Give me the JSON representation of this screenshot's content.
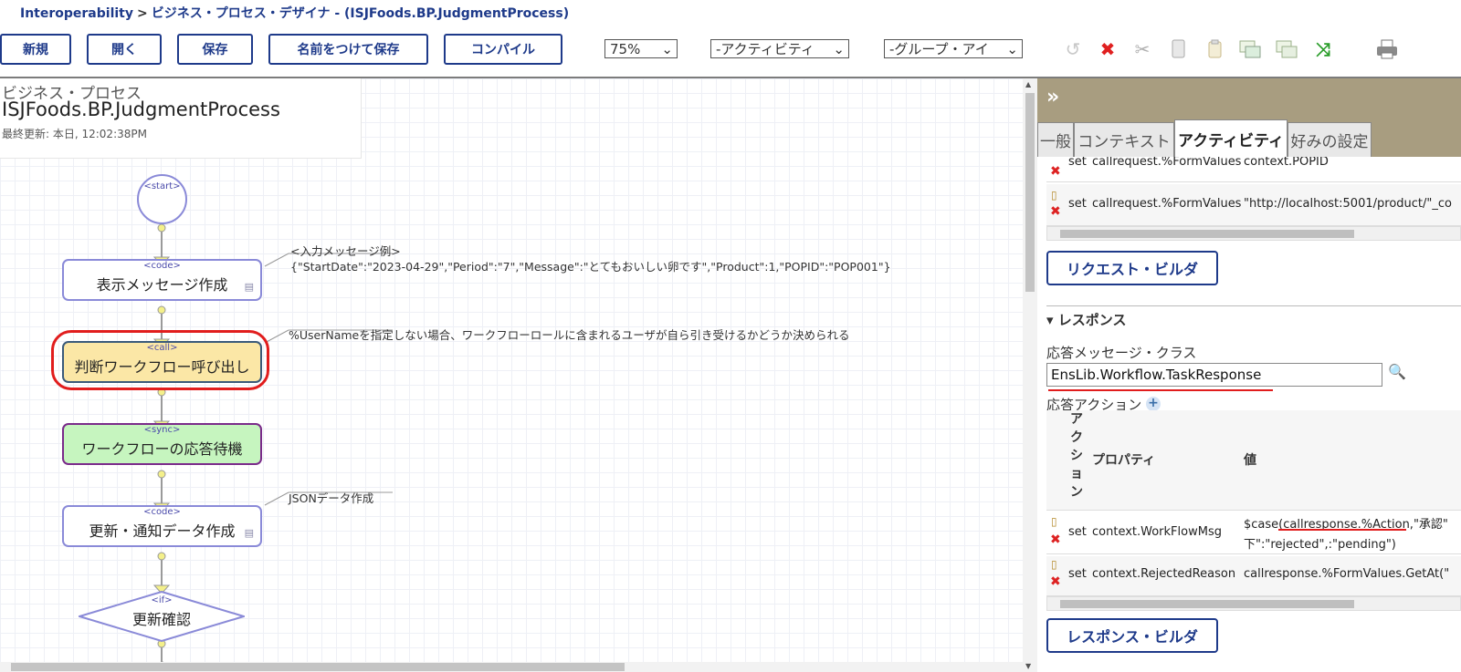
{
  "breadcrumb": {
    "root": "Interoperability",
    "separator": ">",
    "page": "ビジネス・プロセス・デザイナ",
    "suffix": "- (ISJFoods.BP.JudgmentProcess)"
  },
  "toolbar": {
    "buttons": [
      "新規",
      "開く",
      "保存",
      "名前をつけて保存",
      "コンパイル"
    ],
    "zoom": "75%",
    "activity_select": "-アクティビティ",
    "group_select": "-グループ・アイ",
    "icons": [
      "undo-icon",
      "delete-icon",
      "cut-icon",
      "copy-icon",
      "paste-icon",
      "group-icon",
      "ungroup-icon",
      "shuffle-icon",
      "print-icon"
    ]
  },
  "canvas": {
    "header": {
      "kind": "ビジネス・プロセス",
      "name": "ISJFoods.BP.JudgmentProcess",
      "updated": "最終更新: 本日, 12:02:38PM"
    },
    "start": "<start>",
    "nodes": [
      {
        "tag": "<code>",
        "label": "表示メッセージ作成"
      },
      {
        "tag": "<call>",
        "label": "判断ワークフロー呼び出し"
      },
      {
        "tag": "<sync>",
        "label": "ワークフローの応答待機"
      },
      {
        "tag": "<code>",
        "label": "更新・通知データ作成"
      },
      {
        "tag": "<if>",
        "label": "更新確認"
      }
    ],
    "annotations": [
      {
        "title": "<入力メッセージ例>",
        "text": "{\"StartDate\":\"2023-04-29\",\"Period\":\"7\",\"Message\":\"とてもおいしい卵です\",\"Product\":1,\"POPID\":\"POP001\"}"
      },
      {
        "text": "%UserNameを指定しない場合、ワークフローロールに含まれるユーザが自ら引き受けるかどうか決められる"
      },
      {
        "text": "JSONデータ作成"
      }
    ]
  },
  "panel": {
    "collapse": "»",
    "tabs": [
      "一般",
      "コンテキスト",
      "アクティビティ",
      "好みの設定"
    ],
    "active_tab": "アクティビティ",
    "request_rows": [
      {
        "action": "set",
        "property": "callrequest.%FormValues",
        "value": "context.POPID"
      },
      {
        "action": "set",
        "property": "callrequest.%FormValues",
        "value": "\"http://localhost:5001/product/\"_co"
      }
    ],
    "request_builder": "リクエスト・ビルダ",
    "response_section": "▾ レスポンス",
    "response_class_label": "応答メッセージ・クラス",
    "response_class_value": "EnsLib.Workflow.TaskResponse",
    "response_actions_label": "応答アクション",
    "columns": {
      "action": "アクション",
      "property": "プロパティ",
      "value": "値"
    },
    "response_rows": [
      {
        "action": "set",
        "property": "context.WorkFlowMsg",
        "value_line1": "$case(callresponse.%Action,\"承認\"",
        "value_line2": "下\":\"rejected\",:\"pending\")"
      },
      {
        "action": "set",
        "property": "context.RejectedReason",
        "value": "callresponse.%FormValues.GetAt(\""
      }
    ],
    "response_builder": "レスポンス・ビルダ"
  },
  "colors": {
    "accent": "#1e3a8a",
    "call_fill": "#fbe7a6",
    "sync_fill": "#c6f5bf",
    "highlight": "#e11d1d",
    "panel_bar": "#a89d80"
  }
}
